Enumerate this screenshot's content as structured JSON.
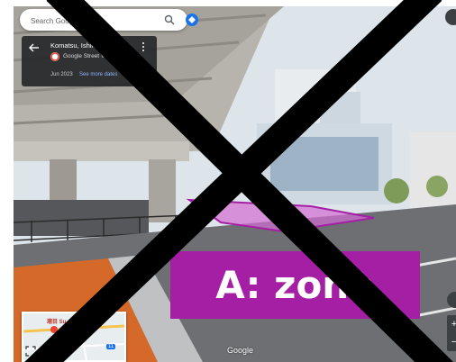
{
  "search": {
    "placeholder": "Search Google Maps",
    "value": "Search Goog"
  },
  "info_card": {
    "title": "Komatsu, Ishika",
    "source": "Google Street Vie",
    "date": "Jun 2023",
    "see_more_dates": "See more dates"
  },
  "zone_label": "A: zone",
  "minimap": {
    "label": "瑠目 Su",
    "badge": "11"
  },
  "zoom": {
    "in": "+",
    "out": "−"
  },
  "attribution": "Google",
  "colors": {
    "zone": "#a51fa5",
    "x_overlay": "#000000"
  }
}
